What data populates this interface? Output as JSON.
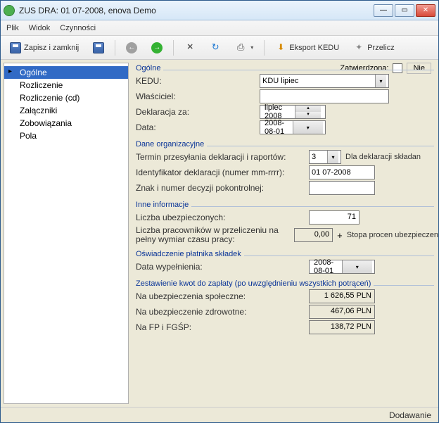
{
  "window": {
    "title": "ZUS DRA: 01 07-2008, enova Demo"
  },
  "menu": {
    "file": "Plik",
    "view": "Widok",
    "actions": "Czynności"
  },
  "toolbar": {
    "save_close": "Zapisz i zamknij",
    "export_kedu": "Eksport KEDU",
    "recalc": "Przelicz"
  },
  "nav": {
    "items": [
      {
        "label": "Ogólne",
        "selected": true,
        "hasChild": true
      },
      {
        "label": "Rozliczenie"
      },
      {
        "label": "Rozliczenie (cd)"
      },
      {
        "label": "Załączniki"
      },
      {
        "label": "Zobowiązania"
      },
      {
        "label": "Pola"
      }
    ]
  },
  "form": {
    "group_general": "Ogólne",
    "approved_label": "Zatwierdzona:",
    "approved_value": "Nie",
    "kedu_label": "KEDU:",
    "kedu_value": "KDU lipiec",
    "owner_label": "Właściciel:",
    "owner_value": "",
    "decl_for_label": "Deklaracja za:",
    "decl_for_value": "lipiec 2008",
    "date_label": "Data:",
    "date_value": "2008-08-01",
    "group_org": "Dane organizacyjne",
    "termin_label": "Termin przesyłania deklaracji i raportów:",
    "termin_value": "3",
    "termin_note": "Dla deklaracji składan",
    "ident_label": "Identyfikator deklaracji (numer mm-rrrr):",
    "ident_value": "01 07-2008",
    "znak_label": "Znak i numer decyzji pokontrolnej:",
    "znak_value": "",
    "group_other": "Inne informacje",
    "liczba_ub_label": "Liczba ubezpieczonych:",
    "liczba_ub_value": "71",
    "liczba_prac_label": "Liczba pracowników w przeliczeniu na pełny wymiar czasu pracy:",
    "liczba_prac_value": "0,00",
    "liczba_prac_note": "Stopa procen ubezpieczen",
    "group_osw": "Oświadczenie płatnika składek",
    "data_wyp_label": "Data wypełnienia:",
    "data_wyp_value": "2008-08-01",
    "group_zest": "Zestawienie kwot do zapłaty (po uwzględnieniu wszystkich potrąceń)",
    "na_spol_label": "Na ubezpieczenia społeczne:",
    "na_spol_value": "1 626,55 PLN",
    "na_zdrow_label": "Na ubezpieczenie zdrowotne:",
    "na_zdrow_value": "467,06 PLN",
    "na_fp_label": "Na FP i FGŚP:",
    "na_fp_value": "138,72 PLN"
  },
  "status": {
    "mode": "Dodawanie"
  }
}
